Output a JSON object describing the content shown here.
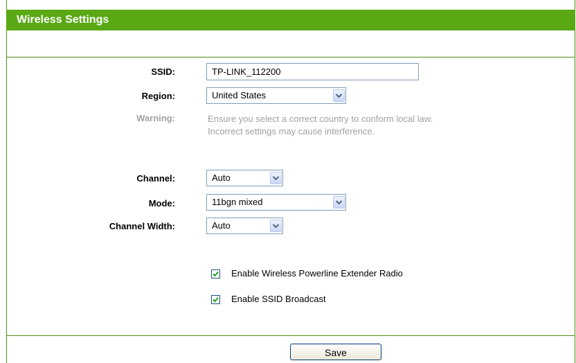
{
  "section": {
    "title": "Wireless Settings"
  },
  "ssid": {
    "label": "SSID:",
    "value": "TP-LINK_112200"
  },
  "region": {
    "label": "Region:",
    "selected": "United States"
  },
  "warning": {
    "label": "Warning:",
    "line1": "Ensure you select a correct country to conform local law.",
    "line2": "Incorrect settings may cause interference."
  },
  "channel": {
    "label": "Channel:",
    "selected": "Auto"
  },
  "mode": {
    "label": "Mode:",
    "selected": "11bgn mixed"
  },
  "channel_width": {
    "label": "Channel Width:",
    "selected": "Auto"
  },
  "options": {
    "enable_radio": {
      "label": "Enable Wireless Powerline Extender Radio",
      "checked": true
    },
    "enable_ssid_broadcast": {
      "label": "Enable SSID Broadcast",
      "checked": true
    }
  },
  "actions": {
    "save_label": "Save"
  },
  "colors": {
    "header_bg": "#59a814",
    "border": "#4f8a10",
    "muted_text": "#a0a0a0"
  }
}
